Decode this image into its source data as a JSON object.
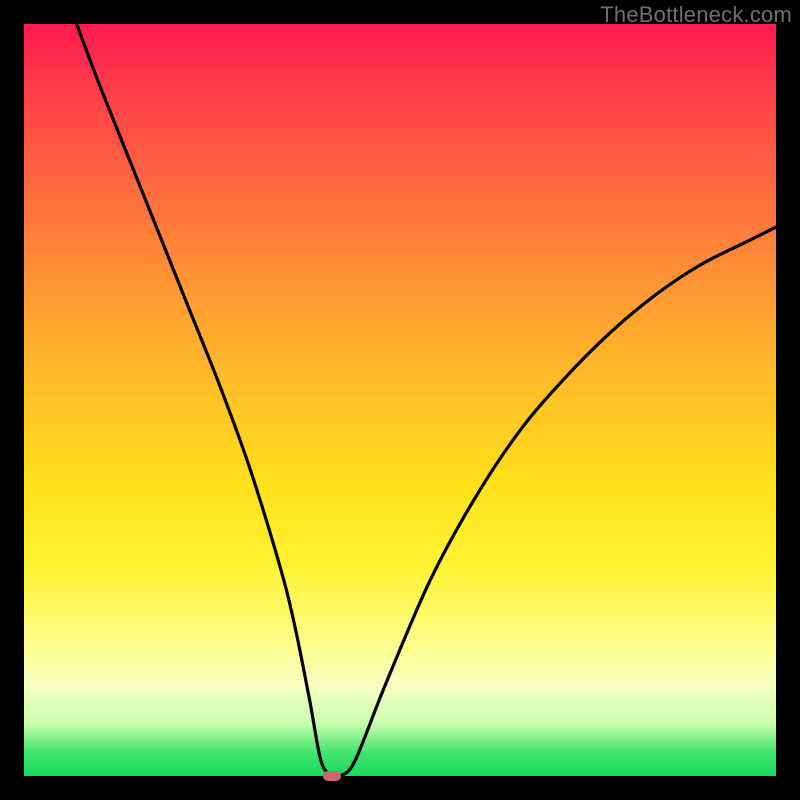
{
  "watermark": "TheBottleneck.com",
  "chart_data": {
    "type": "line",
    "title": "",
    "xlabel": "",
    "ylabel": "",
    "xlim": [
      0,
      100
    ],
    "ylim": [
      0,
      100
    ],
    "background_gradient": {
      "orientation": "vertical",
      "stops": [
        {
          "pos": 0,
          "color": "#ff1a4f"
        },
        {
          "pos": 50,
          "color": "#ffc326"
        },
        {
          "pos": 82,
          "color": "#fdfd86"
        },
        {
          "pos": 97,
          "color": "#3fe46a"
        },
        {
          "pos": 100,
          "color": "#18d85e"
        }
      ]
    },
    "series": [
      {
        "name": "bottleneck-curve",
        "x": [
          7,
          10,
          14,
          18,
          22,
          26,
          30,
          34,
          36,
          38,
          39.5,
          41,
          42,
          44,
          48,
          54,
          60,
          66,
          72,
          78,
          84,
          90,
          96,
          100
        ],
        "y": [
          100,
          92,
          82,
          72,
          62,
          52,
          41,
          28,
          20,
          10,
          2,
          0,
          0,
          2,
          12,
          26,
          37,
          46,
          53,
          59,
          64,
          68,
          71,
          73
        ]
      }
    ],
    "marker": {
      "x": 41,
      "y": 0,
      "color": "#c96a6a"
    },
    "grid": false,
    "legend": false
  }
}
